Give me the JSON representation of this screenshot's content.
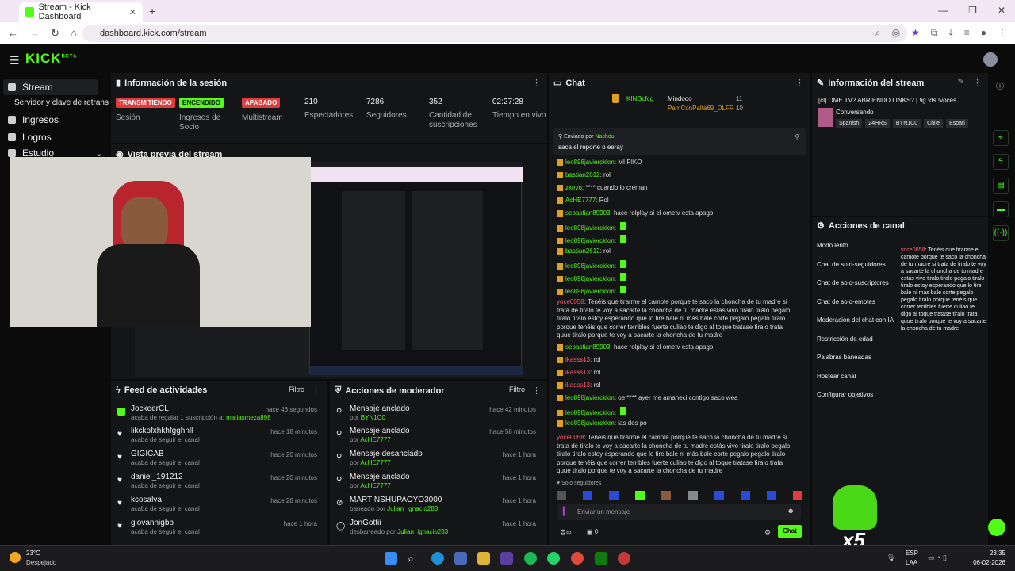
{
  "browser": {
    "tab_title": "Stream - Kick Dashboard",
    "url": "dashboard.kick.com/stream"
  },
  "app": {
    "logo": "KICK",
    "logo_sup": "BETA"
  },
  "sidebar": {
    "items": [
      {
        "label": "Stream",
        "icon": "stream-icon"
      },
      {
        "label": "Servidor y clave de retransmisión",
        "icon": ""
      },
      {
        "label": "Ingresos",
        "icon": "wallet-icon"
      },
      {
        "label": "Logros",
        "icon": "trophy-icon"
      },
      {
        "label": "Estudio",
        "icon": "studio-icon"
      }
    ]
  },
  "session": {
    "title": "Información de la sesión",
    "stats": [
      {
        "badge": "TRANSMITIENDO",
        "label": "Sesión",
        "color": "#e23b3b"
      },
      {
        "badge": "ENCENDIDO",
        "label": "Ingresos de Socio",
        "color": "#53fc18"
      },
      {
        "badge": "APAGADO",
        "label": "Multistream",
        "color": "#e23b3b"
      },
      {
        "value": "210",
        "label": "Espectadores"
      },
      {
        "value": "7286",
        "label": "Seguidores"
      },
      {
        "value": "352",
        "label": "Cantidad de suscripciones"
      },
      {
        "value": "02:27:28",
        "label": "Tiempo en vivo"
      }
    ]
  },
  "preview": {
    "title": "Vista previa del stream"
  },
  "feed": {
    "title": "Feed de actividades",
    "filter": "Filtro",
    "rows": [
      {
        "name": "JockeerCL",
        "desc": "acaba de regalar 1 suscripción a:",
        "target": "matiasmeza898",
        "time": "hace 46 segundos"
      },
      {
        "name": "likckofxhkhfgghnll",
        "desc": "acaba de seguir el canal",
        "target": "",
        "time": "hace 18 minutos"
      },
      {
        "name": "GIGICAB",
        "desc": "acaba de seguir el canal",
        "target": "",
        "time": "hace 20 minutos"
      },
      {
        "name": "daniel_191212",
        "desc": "acaba de seguir el canal",
        "target": "",
        "time": "hace 20 minutos"
      },
      {
        "name": "kcosalva",
        "desc": "acaba de seguir el canal",
        "target": "",
        "time": "hace 28 minutos"
      },
      {
        "name": "giovannigbb",
        "desc": "acaba de seguir el canal",
        "target": "",
        "time": "hace 1 hora"
      }
    ]
  },
  "modactions": {
    "title": "Acciones de moderador",
    "filter": "Filtro",
    "rows": [
      {
        "name": "Mensaje anclado",
        "desc": "por",
        "target": "BYN1C0",
        "time": "hace 42 minutos"
      },
      {
        "name": "Mensaje anclado",
        "desc": "por",
        "target": "AcHE7777",
        "time": "hace 58 minutos"
      },
      {
        "name": "Mensaje desanclado",
        "desc": "por",
        "target": "AcHE7777",
        "time": "hace 1 hora"
      },
      {
        "name": "Mensaje anclado",
        "desc": "por",
        "target": "AcHE7777",
        "time": "hace 1 hora"
      },
      {
        "name": "MARTINSHUPAOYO3000",
        "desc": "baneado por",
        "target": "Julian_ignacio283",
        "time": "hace 1 hora"
      },
      {
        "name": "JonGottii",
        "desc": "desbaneado por",
        "target": "Julian_ignacio283",
        "time": "hace 1 hora"
      }
    ]
  },
  "chat": {
    "title": "Chat",
    "top": [
      {
        "name": "KINGcfcg",
        "value": "11"
      },
      {
        "name": "Mindooo",
        "value": "11"
      },
      {
        "name": "PamConPalta69_DLFR",
        "value": "10"
      }
    ],
    "pinned": {
      "label": "Enviado por",
      "by": "Nachou",
      "text": "saca el reporte o eeray"
    },
    "messages": [
      {
        "user": "leo898javierckkm",
        "text": "MI PIKO",
        "red": false
      },
      {
        "user": "bastian2612",
        "text": "rol",
        "red": false
      },
      {
        "user": "zkeyo",
        "text": "**** cuando lo creman",
        "red": false
      },
      {
        "user": "AcHE7777",
        "text": "Rol",
        "red": false
      },
      {
        "user": "sebastian89903",
        "text": "hace rolplay si el ometv esta apago",
        "red": false
      },
      {
        "user": "leo898javierckkm",
        "text": "",
        "red": false
      },
      {
        "user": "leo898javierckkm",
        "text": "",
        "red": false
      },
      {
        "user": "bastian2612",
        "text": "rol",
        "red": false
      },
      {
        "user": "leo898javierckkm",
        "text": "",
        "red": false
      },
      {
        "user": "leo898javierckkm",
        "text": "",
        "red": false
      },
      {
        "user": "leo898javierckkm",
        "text": "",
        "red": false
      }
    ],
    "long1": "Tenéis que tirarme el camote porque te saco la choncha de tu madre si trata de tiralo te voy a sacarte la choncha de tu madre estás vivo tiralo tiralo pegalo tiralo tiralo estoy esperando que lo tire bale ni más bale corte pegalo pegalo tiralo porque tenéis que correr terribles fuerte culiao te digo al toque tratase tiralo trata quue tiralo porque te voy a sacarte la choncha de tu madre",
    "long1_user": "yoce0058",
    "mid": [
      {
        "user": "sebastian89903",
        "text": "hace rolplay si el ometv esta apago",
        "red": false
      },
      {
        "user": "ikasss13",
        "text": "rol",
        "red": true
      },
      {
        "user": "ikasss13",
        "text": "rol",
        "red": true
      },
      {
        "user": "ikasss13",
        "text": "rol",
        "red": true
      },
      {
        "user": "leo898javierckkm",
        "text": "oe **** ayer me amaneci contigo saco wea",
        "red": false
      },
      {
        "user": "leo898javierckkm",
        "text": "",
        "red": false
      },
      {
        "user": "leo898javierckkm",
        "text": "las dos po",
        "red": false
      }
    ],
    "solo": "Solo seguidores",
    "input_placeholder": "Enviar un mensaje",
    "count": "0",
    "send": "Chat"
  },
  "streaminfo": {
    "title": "Información del stream",
    "stream_title": "[cl] OME TV? ABRIENDO LINKS? | !ig !ds !voces",
    "category": "Conversando",
    "tags": [
      "Spanish",
      "24HRS",
      "BYN1C0",
      "Chile",
      "Españ"
    ]
  },
  "channelactions": {
    "title": "Acciones de canal",
    "items": [
      "Modo lento",
      "Chat de solo-seguidores",
      "Chat de solo-suscriptores",
      "Chat de solo-emotes",
      "Moderación del chat con IA",
      "Restricción de edad",
      "Palabras baneadas",
      "Hostear canal",
      "Configurar objetivos"
    ]
  },
  "taskbar": {
    "temp": "23°C",
    "weather": "Despejado",
    "lang1": "ESP",
    "lang2": "LAA",
    "time": "23:35",
    "date": "06-02-2026"
  },
  "overlay": {
    "combo": "x5"
  },
  "colors": {
    "accent": "#53fc18",
    "danger": "#e23b3b",
    "panel": "#141517"
  }
}
